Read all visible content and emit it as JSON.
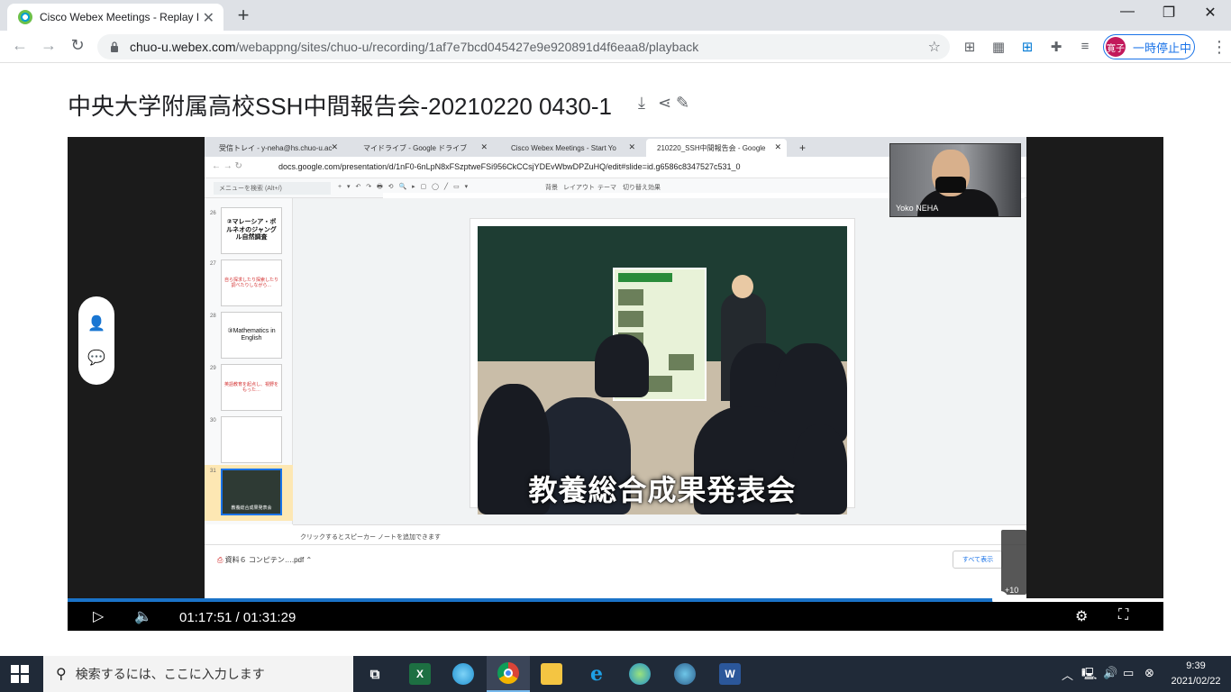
{
  "browser": {
    "tab_title": "Cisco Webex Meetings - Replay R",
    "new_tab_icon": "plus-icon",
    "url_domain": "chuo-u.webex.com",
    "url_path": "/webappng/sites/chuo-u/recording/1af7e7bcd045427e9e920891d4f6eaa8/playback",
    "profile_initials": "寛子",
    "profile_label": "一時停止中"
  },
  "page": {
    "title": "中央大学附属高校SSH中間報告会-20210220 0430-1"
  },
  "shared_screen": {
    "tabs": [
      {
        "label": "受信トレイ - y-neha@hs.chuo-u.ac"
      },
      {
        "label": "マイドライブ - Google ドライブ"
      },
      {
        "label": "Cisco Webex Meetings - Start Yo"
      },
      {
        "label": "210220_SSH中間報告会 - Google"
      }
    ],
    "url": "docs.google.com/presentation/d/1nF0-6nLpN8xFSzptweFSi956CkCCsjYDEvWbwDPZuHQ/edit#slide=id.g6586c8347527c531_0",
    "menu_search": "メニューを検索 (Alt+/)",
    "toolbar_labels": [
      "背景",
      "レイアウト",
      "テーマ",
      "切り替え効果"
    ],
    "thumbnails": [
      {
        "num": "26",
        "text": "②マレーシア・ボルネオのジャングル自然調査"
      },
      {
        "num": "27",
        "text": "自ら探求したり探索したり調べたりしながら…"
      },
      {
        "num": "28",
        "text": "③Mathematics in English"
      },
      {
        "num": "29",
        "text": "英語教育を起点し、視野をもった…"
      },
      {
        "num": "30",
        "text": ""
      },
      {
        "num": "31",
        "text": "教養総合成果発表会"
      }
    ],
    "slide_caption": "教養総合成果発表会",
    "notes_placeholder": "クリックするとスピーカー ノートを追加できます",
    "download_file": "資料６ コンピテン….pdf",
    "show_all": "すべて表示"
  },
  "webcam": {
    "name": "Yoko NEHA"
  },
  "player": {
    "current_time": "01:17:51",
    "total_time": "01:31:29",
    "time_display": "01:17:51 / 01:31:29",
    "progress_fraction": 0.851,
    "skip_label": "+10"
  },
  "taskbar": {
    "search_placeholder": "検索するには、ここに入力します",
    "time": "9:39",
    "date": "2021/02/22"
  },
  "colors": {
    "progress": "#1a73c8",
    "accent": "#1a73e8",
    "taskbar": "#202a38"
  }
}
